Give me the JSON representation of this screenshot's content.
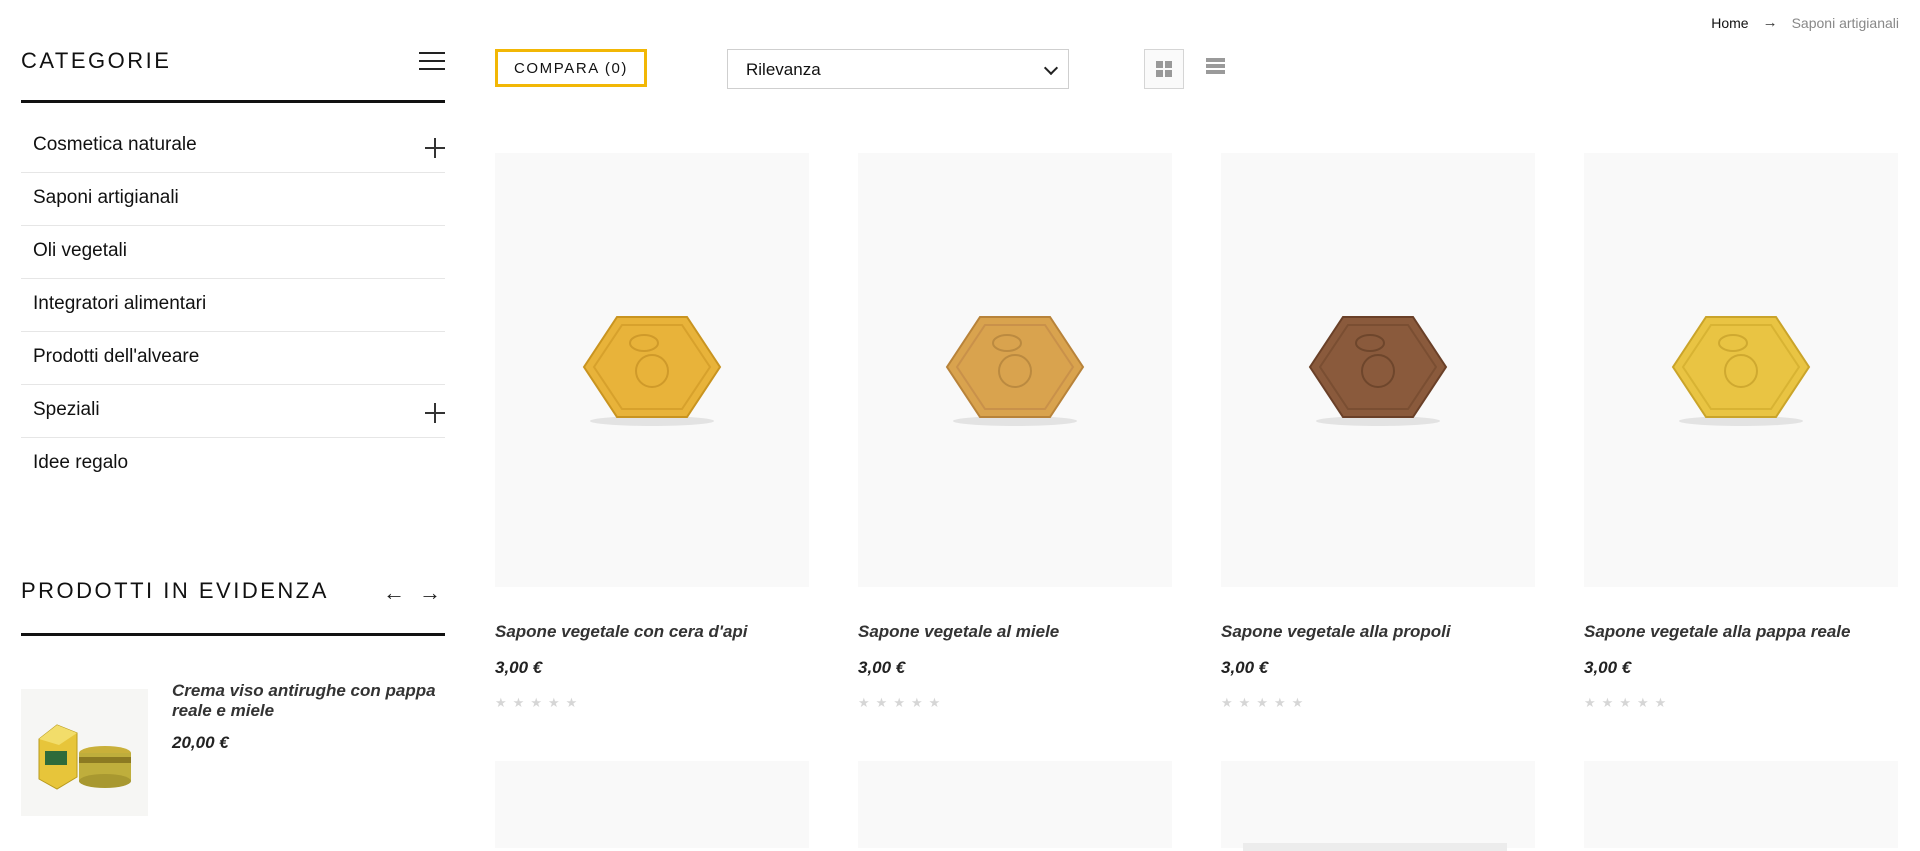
{
  "breadcrumb": {
    "home": "Home",
    "current": "Saponi artigianali"
  },
  "sidebar": {
    "title": "CATEGORIE",
    "items": [
      {
        "label": "Cosmetica naturale",
        "expandable": true
      },
      {
        "label": "Saponi artigianali",
        "expandable": false
      },
      {
        "label": "Oli vegetali",
        "expandable": false
      },
      {
        "label": "Integratori alimentari",
        "expandable": false
      },
      {
        "label": "Prodotti dell'alveare",
        "expandable": false
      },
      {
        "label": "Speziali",
        "expandable": true
      },
      {
        "label": "Idee regalo",
        "expandable": false
      }
    ],
    "featured_title": "PRODOTTI IN EVIDENZA",
    "featured": {
      "name": "Crema viso antirughe con pappa reale e miele",
      "price": "20,00 €"
    }
  },
  "toolbar": {
    "compare_label": "COMPARA (0)",
    "sort_selected": "Rilevanza"
  },
  "products": [
    {
      "name": "Sapone vegetale con cera d'api",
      "price": "3,00 €",
      "rating": 0,
      "color": "#e8b33a"
    },
    {
      "name": "Sapone vegetale al miele",
      "price": "3,00 €",
      "rating": 0,
      "color": "#d9a34e"
    },
    {
      "name": "Sapone vegetale alla propoli",
      "price": "3,00 €",
      "rating": 0,
      "color": "#8a5a3c"
    },
    {
      "name": "Sapone vegetale alla pappa reale",
      "price": "3,00 €",
      "rating": 0,
      "color": "#e9c443"
    }
  ],
  "colors": {
    "accent": "#f2b705",
    "text": "#111111",
    "star": "#d6d6d6"
  },
  "icons": [
    "hamburger-icon",
    "plus-icon",
    "arrow-left-icon",
    "arrow-right-icon",
    "chevron-down-icon",
    "grid-view-icon",
    "list-view-icon",
    "star-icon"
  ]
}
